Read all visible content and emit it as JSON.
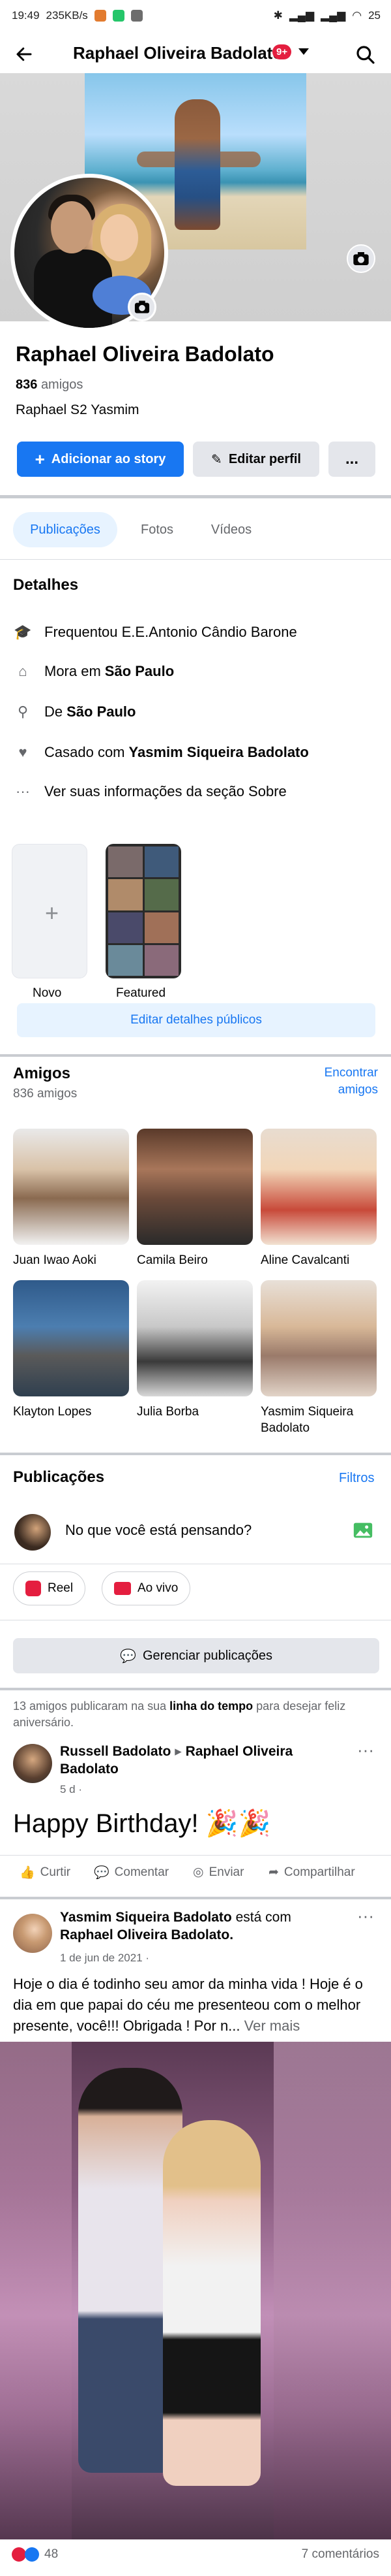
{
  "status_bar": {
    "time": "19:49",
    "speed": "235KB/s",
    "battery": "25"
  },
  "header": {
    "title": "Raphael Oliveira Badolato",
    "badge": "9+"
  },
  "profile": {
    "name": "Raphael Oliveira Badolato",
    "friends_count": "836",
    "friends_suffix": "amigos",
    "bio": "Raphael S2 Yasmim",
    "add_story_label": "Adicionar ao story",
    "edit_profile_label": "Editar perfil",
    "more_label": "..."
  },
  "tabs": [
    "Publicações",
    "Fotos",
    "Vídeos"
  ],
  "details": {
    "title": "Detalhes",
    "rows": [
      {
        "prefix": "Frequentou E.E.Antonio Cândio Barone",
        "bold": ""
      },
      {
        "prefix": "Mora em",
        "bold": "São Paulo"
      },
      {
        "prefix": "De",
        "bold": "São Paulo"
      },
      {
        "prefix": "Casado com",
        "bold": "Yasmim Siqueira Badolato"
      },
      {
        "prefix": "Ver suas informações da seção Sobre",
        "bold": ""
      }
    ]
  },
  "stories": {
    "new_label": "Novo",
    "featured_label": "Featured",
    "edit_button": "Editar detalhes públicos"
  },
  "friends": {
    "title": "Amigos",
    "count_text": "836 amigos",
    "find_link": "Encontrar amigos",
    "list": [
      {
        "name": "Juan Iwao Aoki"
      },
      {
        "name": "Camila Beiro"
      },
      {
        "name": "Aline Cavalcanti"
      },
      {
        "name": "Klayton Lopes"
      },
      {
        "name": "Julia Borba"
      },
      {
        "name": "Yasmim Siqueira Badolato"
      }
    ]
  },
  "posts_section": {
    "title": "Publicações",
    "filters": "Filtros",
    "composer_placeholder": "No que você está pensando?",
    "reel_label": "Reel",
    "live_label": "Ao vivo",
    "manage_label": "Gerenciar publicações"
  },
  "birthday_note": {
    "pre": "13 amigos publicaram na sua",
    "bold": "linha do tempo",
    "post": "para desejar feliz aniversário."
  },
  "post1": {
    "author": "Russell Badolato",
    "arrow": "▸",
    "target": "Raphael Oliveira Badolato",
    "time": "5 d ·",
    "text": "Happy Birthday! 🎉🎉",
    "actions": [
      "Curtir",
      "Comentar",
      "Enviar",
      "Compartilhar"
    ]
  },
  "post2": {
    "author": "Yasmim Siqueira Badolato",
    "with_text": "está com",
    "with_name": "Raphael Oliveira Badolato.",
    "date": "1 de jun de 2021 ·",
    "text": "Hoje o dia é todinho seu amor da minha vida ! Hoje é o dia em que papai do céu me presenteou com o melhor presente, você!!! Obrigada ! Por n...",
    "more": "Ver mais",
    "reactions": "48",
    "comments": "7 comentários"
  },
  "colors": {
    "accent": "#1877f2",
    "badge": "#e41e3f",
    "secondary_bg": "#e4e6eb",
    "text_muted": "#65676b"
  }
}
